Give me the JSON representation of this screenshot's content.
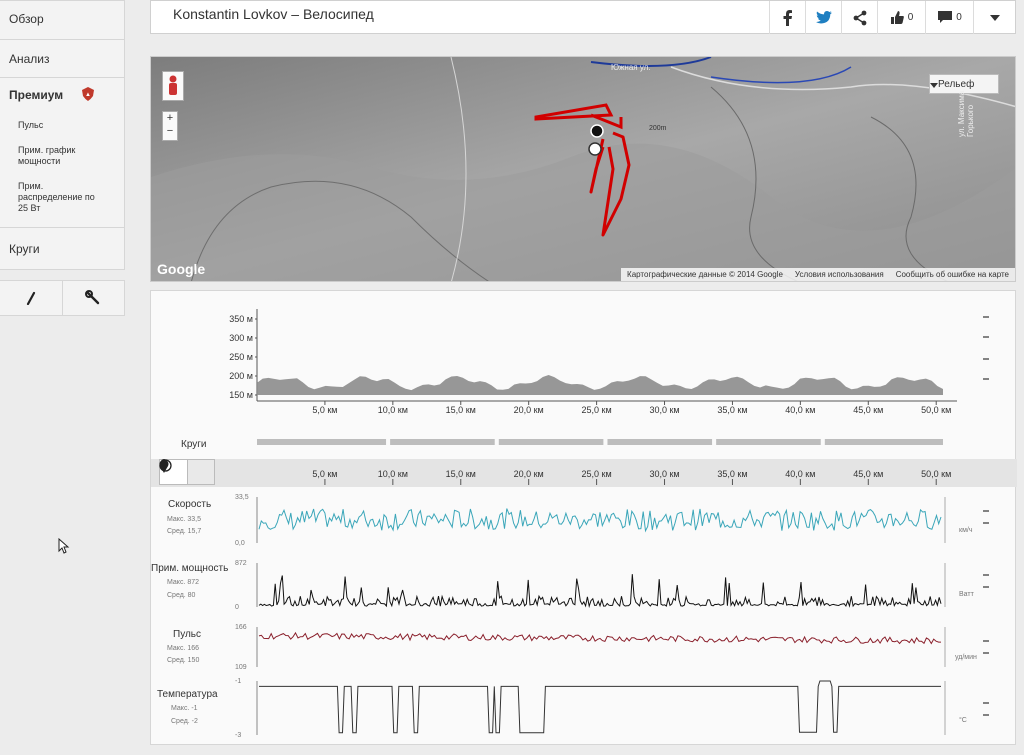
{
  "sidebar": {
    "overview": "Обзор",
    "analysis": "Анализ",
    "premium": "Премиум",
    "premium_items": [
      "Пульс",
      "Прим. график мощности",
      "Прим. распределение по 25 Вт"
    ],
    "laps": "Круги"
  },
  "header": {
    "title": "Konstantin Lovkov – Велосипед",
    "like_count": "0",
    "comment_count": "0"
  },
  "map": {
    "relief_label": "Рельеф",
    "google_logo": "Google",
    "attribution": [
      "Картографические данные © 2014 Google",
      "Условия использования",
      "Сообщить об ошибке на карте"
    ],
    "street_labels": [
      "Южная ул.",
      "ул. Максима Горького"
    ],
    "contour_label": "200m",
    "zoom_in": "+",
    "zoom_out": "−"
  },
  "elevation": {
    "ticks": [
      "350 м",
      "300 м",
      "250 м",
      "200 м",
      "150 м"
    ],
    "x_ticks": [
      "5,0 км",
      "10,0 км",
      "15,0 км",
      "20,0 км",
      "25,0 км",
      "30,0 км",
      "35,0 км",
      "40,0 км",
      "45,0 км",
      "50,0 км"
    ],
    "laps_label": "Круги"
  },
  "metrics": {
    "x_ticks": [
      "5,0 км",
      "10,0 км",
      "15,0 км",
      "20,0 км",
      "25,0 км",
      "30,0 км",
      "35,0 км",
      "40,0 км",
      "45,0 км",
      "50,0 км"
    ],
    "speed": {
      "name": "Скорость",
      "max_label": "Макс. 33,5",
      "avg_label": "Сред. 15,7",
      "top": "33,5",
      "bottom": "0,0",
      "unit": "км/ч",
      "color": "#3aa6b9"
    },
    "power": {
      "name": "Прим. мощность",
      "max_label": "Макс. 872",
      "avg_label": "Сред. 80",
      "top": "872",
      "bottom": "0",
      "unit": "Ватт",
      "color": "#111111"
    },
    "hr": {
      "name": "Пульс",
      "max_label": "Макс. 166",
      "avg_label": "Сред. 150",
      "top": "166",
      "bottom": "109",
      "unit": "уд/мин",
      "color": "#8a1f2b"
    },
    "temp": {
      "name": "Температура",
      "max_label": "Макс. -1",
      "avg_label": "Сред. -2",
      "top": "-1",
      "bottom": "-3",
      "unit": "°C",
      "color": "#333333"
    }
  },
  "icons": {
    "marker": "map-marker-icon",
    "clock": "clock-icon",
    "pencil": "pencil-icon",
    "wrench": "wrench-icon",
    "facebook": "facebook-icon",
    "twitter": "twitter-icon",
    "share": "share-icon",
    "like": "thumbs-up-icon",
    "comment": "comment-icon",
    "dropdown": "caret-down-icon"
  }
}
